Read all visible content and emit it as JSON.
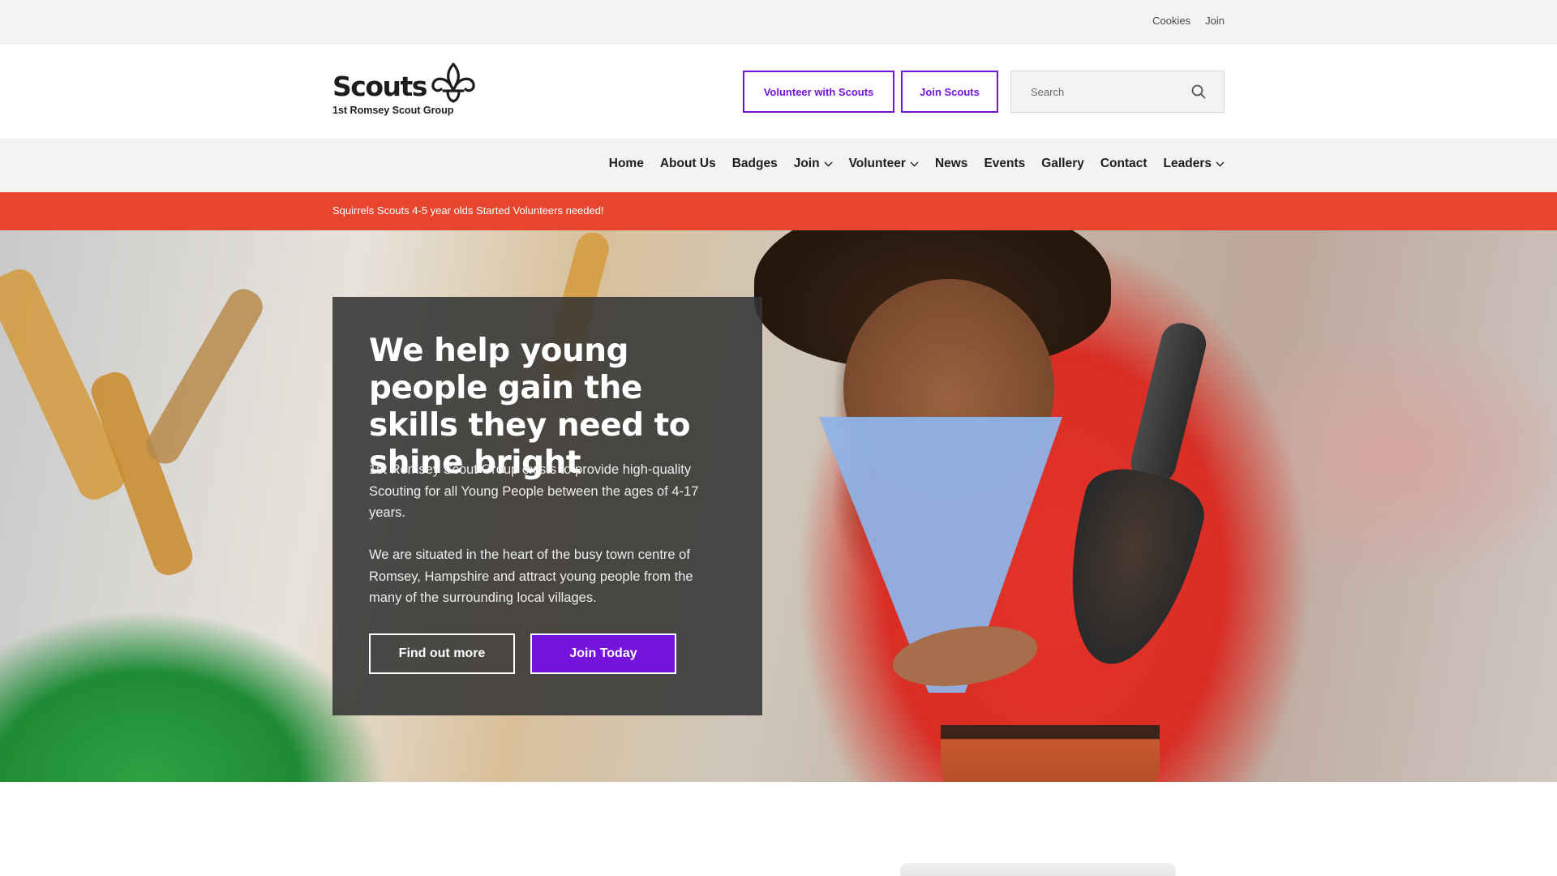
{
  "utility": {
    "links": [
      "Cookies",
      "Join"
    ]
  },
  "header": {
    "logo_word": "Scouts",
    "group_name": "1st Romsey Scout Group",
    "volunteer_button": "Volunteer with Scouts",
    "join_button": "Join Scouts",
    "search_placeholder": "Search"
  },
  "nav": {
    "items": [
      {
        "label": "Home",
        "dropdown": false
      },
      {
        "label": "About Us",
        "dropdown": false
      },
      {
        "label": "Badges",
        "dropdown": false
      },
      {
        "label": "Join",
        "dropdown": true
      },
      {
        "label": "Volunteer",
        "dropdown": true
      },
      {
        "label": "News",
        "dropdown": false
      },
      {
        "label": "Events",
        "dropdown": false
      },
      {
        "label": "Gallery",
        "dropdown": false
      },
      {
        "label": "Contact",
        "dropdown": false
      },
      {
        "label": "Leaders",
        "dropdown": true
      }
    ]
  },
  "alert": {
    "text": "Squirrels Scouts 4-5 year olds Started Volunteers needed!"
  },
  "hero": {
    "title": "We help young people gain the skills they need to shine bright",
    "paragraph1": "1st Romsey Scout Group exists to provide high-quality Scouting for all Young People between the ages of 4-17 years.",
    "paragraph2": "We are situated in the heart of the busy town centre of Romsey, Hampshire and attract young people from the many of the surrounding local villages.",
    "find_out_more": "Find out more",
    "join_today": "Join Today"
  },
  "colors": {
    "brand_purple": "#7413dc",
    "alert_red": "#e8452f",
    "utility_gray": "#f3f3f3"
  },
  "icons": [
    "fleur-de-lis-logo",
    "search-icon",
    "chevron-down-icon"
  ]
}
